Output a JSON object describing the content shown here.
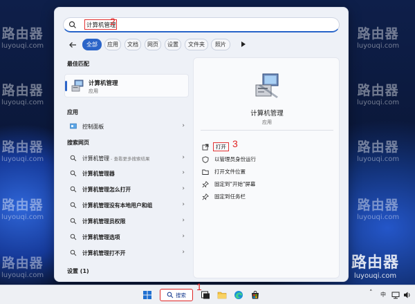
{
  "watermark": {
    "name": "路由器",
    "url": "luyouqi.com"
  },
  "search": {
    "value": "计算机管理",
    "step_label": "2"
  },
  "filters": {
    "tabs": [
      {
        "label": "全部",
        "active": true
      },
      {
        "label": "应用"
      },
      {
        "label": "文档"
      },
      {
        "label": "网页"
      },
      {
        "label": "设置"
      },
      {
        "label": "文件夹"
      },
      {
        "label": "照片"
      }
    ]
  },
  "left": {
    "best_match_header": "最佳匹配",
    "best_match": {
      "title": "计算机管理",
      "subtitle": "应用"
    },
    "apps_header": "应用",
    "apps": [
      {
        "label": "控制面板"
      }
    ],
    "web_header": "搜索网页",
    "web_results": [
      {
        "label": "计算机管理",
        "hint": " - 查看更多搜索结果"
      },
      {
        "label": "计算机管理器"
      },
      {
        "label": "计算机管理怎么打开"
      },
      {
        "label": "计算机管理没有本地用户和组"
      },
      {
        "label": "计算机管理员权限"
      },
      {
        "label": "计算机管理选项"
      },
      {
        "label": "计算机管理打不开"
      }
    ],
    "settings_header": "设置 (1)"
  },
  "detail": {
    "app_name": "计算机管理",
    "app_type": "应用",
    "step_label": "3",
    "actions": [
      {
        "label": "打开",
        "icon": "open-external-icon"
      },
      {
        "label": "以管理员身份运行",
        "icon": "shield-admin-icon"
      },
      {
        "label": "打开文件位置",
        "icon": "folder-icon"
      },
      {
        "label": "固定到\"开始\"屏幕",
        "icon": "pin-icon"
      },
      {
        "label": "固定到任务栏",
        "icon": "pin-icon"
      }
    ]
  },
  "taskbar": {
    "search_label": "搜索",
    "step_label": "1",
    "tray_label": "中",
    "colors": {
      "accent": "#2a64c8",
      "highlight": "#e02424"
    }
  }
}
